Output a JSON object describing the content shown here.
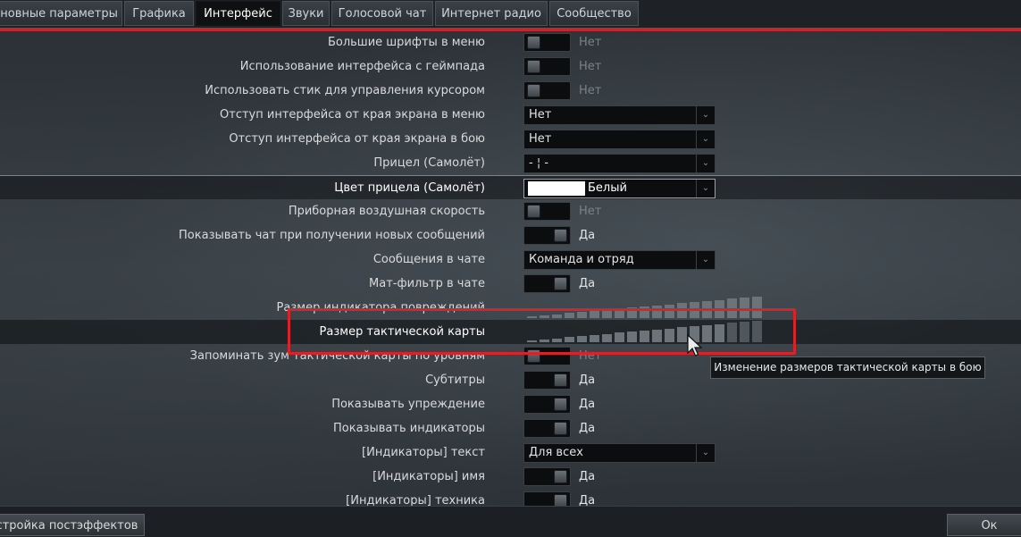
{
  "tabs": [
    {
      "label": "сновные параметры"
    },
    {
      "label": "Графика"
    },
    {
      "label": "Интерфейс"
    },
    {
      "label": "Звуки"
    },
    {
      "label": "Голосовой чат"
    },
    {
      "label": "Интернет радио"
    },
    {
      "label": "Сообщество"
    }
  ],
  "settings": {
    "large_fonts": {
      "label": "Большие шрифты в меню",
      "value": "Нет"
    },
    "gamepad_ui": {
      "label": "Использование интерфейса с геймпада",
      "value": "Нет"
    },
    "stick_cursor": {
      "label": "Использовать стик для управления курсором",
      "value": "Нет"
    },
    "menu_margin": {
      "label": "Отступ интерфейса от края экрана в меню",
      "value": "Нет"
    },
    "battle_margin": {
      "label": "Отступ интерфейса от края экрана в бою",
      "value": "Нет"
    },
    "crosshair": {
      "label": "Прицел (Самолёт)",
      "value": "- ¦ -"
    },
    "crosshair_color": {
      "label": "Цвет прицела (Самолёт)",
      "value": "Белый",
      "swatch_color": "#ffffff"
    },
    "instrument_airspeed": {
      "label": "Приборная воздушная скорость",
      "value": "Нет"
    },
    "chat_on_new": {
      "label": "Показывать чат при получении новых сообщений",
      "value": "Да"
    },
    "chat_messages": {
      "label": "Сообщения в чате",
      "value": "Команда и отряд"
    },
    "profanity_filter": {
      "label": "Мат-фильтр в чате",
      "value": "Да"
    },
    "damage_indicator_size": {
      "label": "Размер индикатора повреждений",
      "level": 1.0
    },
    "tactical_map_size": {
      "label": "Размер тактической карты",
      "level": 0.857
    },
    "remember_zoom": {
      "label": "Запоминать зум тактической карты по уровням",
      "value": "Нет"
    },
    "subtitles": {
      "label": "Субтитры",
      "value": "Да"
    },
    "show_lead": {
      "label": "Показывать упреждение",
      "value": "Да"
    },
    "show_indicators": {
      "label": "Показывать индикаторы",
      "value": "Да"
    },
    "indicators_text": {
      "label": "[Индикаторы] текст",
      "value": "Для всех"
    },
    "indicators_name": {
      "label": "[Индикаторы] имя",
      "value": "Да"
    },
    "indicators_vehicle": {
      "label": "[Индикаторы] техника",
      "value": "Да"
    }
  },
  "tooltip": {
    "text": "Изменение размеров тактической карты в бою"
  },
  "bottom": {
    "posteffects_label": "стройка постэффектов",
    "ok_label": "Ок"
  },
  "colors": {
    "accent_red": "#c0282d",
    "highlight_box": "#d8232a"
  },
  "icons": {
    "dropdown": "chevron-down-icon",
    "cursor": "mouse-pointer-icon"
  }
}
